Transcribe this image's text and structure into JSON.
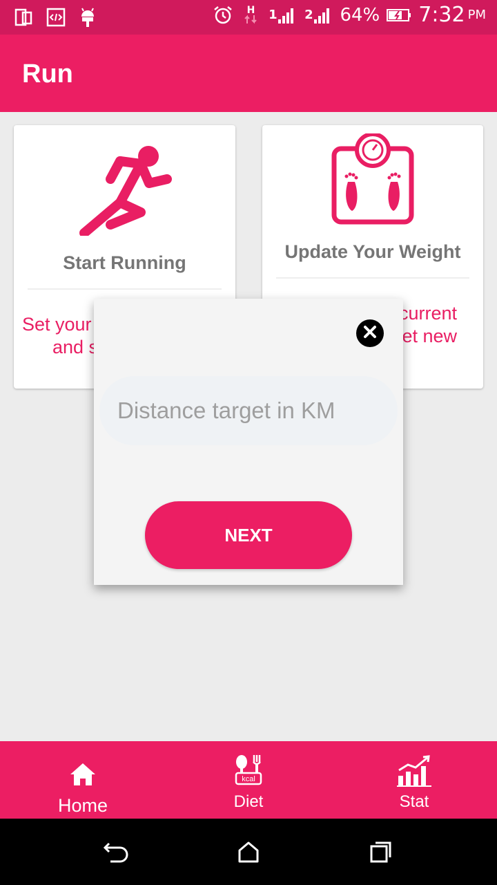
{
  "status_bar": {
    "left_icons": [
      "screen-mirror-icon",
      "code-icon",
      "android-debug-icon"
    ],
    "right_icons": [
      "alarm-icon",
      "network-h-icon",
      "signal-sim1-icon",
      "signal-sim2-icon",
      "battery-charging-icon"
    ],
    "network_type": "H",
    "sim1_label": "1",
    "sim2_label": "2",
    "battery": "64%",
    "time": "7:32",
    "ampm": "PM"
  },
  "app_bar": {
    "title": "Run"
  },
  "cards": [
    {
      "title": "Start Running",
      "icon": "runner-icon",
      "desc_line1": "Set your",
      "desc_line2": "and s"
    },
    {
      "title": "Update Your Weight",
      "icon": "weight-scale-icon",
      "desc_line1": "current",
      "desc_line2": "et new"
    }
  ],
  "dialog": {
    "input_placeholder": "Distance target in KM",
    "input_value": "",
    "next_label": "NEXT",
    "close_icon": "close-icon"
  },
  "bottom_nav": [
    {
      "label": "Home",
      "icon": "home-icon"
    },
    {
      "label": "Diet",
      "icon": "diet-kcal-icon",
      "icon_text": "kcal"
    },
    {
      "label": "Stat",
      "icon": "stat-chart-icon"
    }
  ],
  "system_nav": [
    "back-icon",
    "home-circle-icon",
    "recents-icon"
  ],
  "colors": {
    "primary": "#ec1e63",
    "status_bar": "#d01a5c",
    "card_title": "#757575",
    "card_desc": "#e91e63",
    "background": "#ececec"
  }
}
